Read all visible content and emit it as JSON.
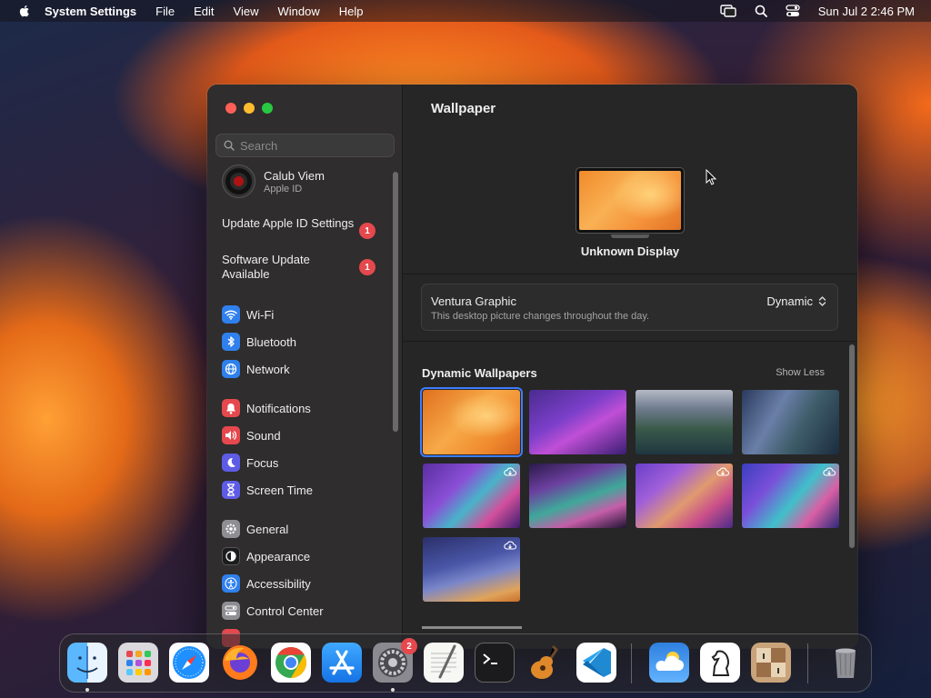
{
  "menubar": {
    "app_name": "System Settings",
    "menus": [
      "File",
      "Edit",
      "View",
      "Window",
      "Help"
    ],
    "datetime": "Sun Jul 2  2:46 PM"
  },
  "sidebar": {
    "search_placeholder": "Search",
    "account": {
      "name": "Calub Viem",
      "subtitle": "Apple ID"
    },
    "notices": [
      {
        "label": "Update Apple ID Settings",
        "badge": "1"
      },
      {
        "label": "Software Update Available",
        "badge": "1"
      }
    ],
    "items": [
      {
        "label": "Wi-Fi",
        "icon": "wifi-icon",
        "color": "#2f80ed"
      },
      {
        "label": "Bluetooth",
        "icon": "bluetooth-icon",
        "color": "#2f80ed"
      },
      {
        "label": "Network",
        "icon": "network-icon",
        "color": "#2f80ed"
      },
      {
        "label": "Notifications",
        "icon": "notifications-icon",
        "color": "#e5484d"
      },
      {
        "label": "Sound",
        "icon": "sound-icon",
        "color": "#e5484d"
      },
      {
        "label": "Focus",
        "icon": "focus-icon",
        "color": "#5e5ce6"
      },
      {
        "label": "Screen Time",
        "icon": "screen-time-icon",
        "color": "#5e5ce6"
      },
      {
        "label": "General",
        "icon": "gear-icon",
        "color": "#8e8e93"
      },
      {
        "label": "Appearance",
        "icon": "appearance-icon",
        "color": "#1c1c1e"
      },
      {
        "label": "Accessibility",
        "icon": "accessibility-icon",
        "color": "#2f80ed"
      },
      {
        "label": "Control Center",
        "icon": "control-center-icon",
        "color": "#8e8e93"
      }
    ]
  },
  "content": {
    "title": "Wallpaper",
    "display_name": "Unknown Display",
    "wallpaper": {
      "name": "Ventura Graphic",
      "description": "This desktop picture changes throughout the day.",
      "mode": "Dynamic"
    },
    "section": {
      "title": "Dynamic Wallpapers",
      "toggle_label": "Show Less"
    }
  },
  "dock": {
    "apps": [
      "Finder",
      "Launchpad",
      "Safari",
      "Firefox",
      "Chrome",
      "App Store",
      "System Settings",
      "TextEdit",
      "Terminal",
      "GarageBand",
      "Visual Studio Code",
      "Weather",
      "Chess",
      "Chess Board",
      "Trash"
    ],
    "system_settings_badge": "2"
  },
  "colors": {
    "accent": "#3d7cff",
    "badge": "#e5484d"
  }
}
